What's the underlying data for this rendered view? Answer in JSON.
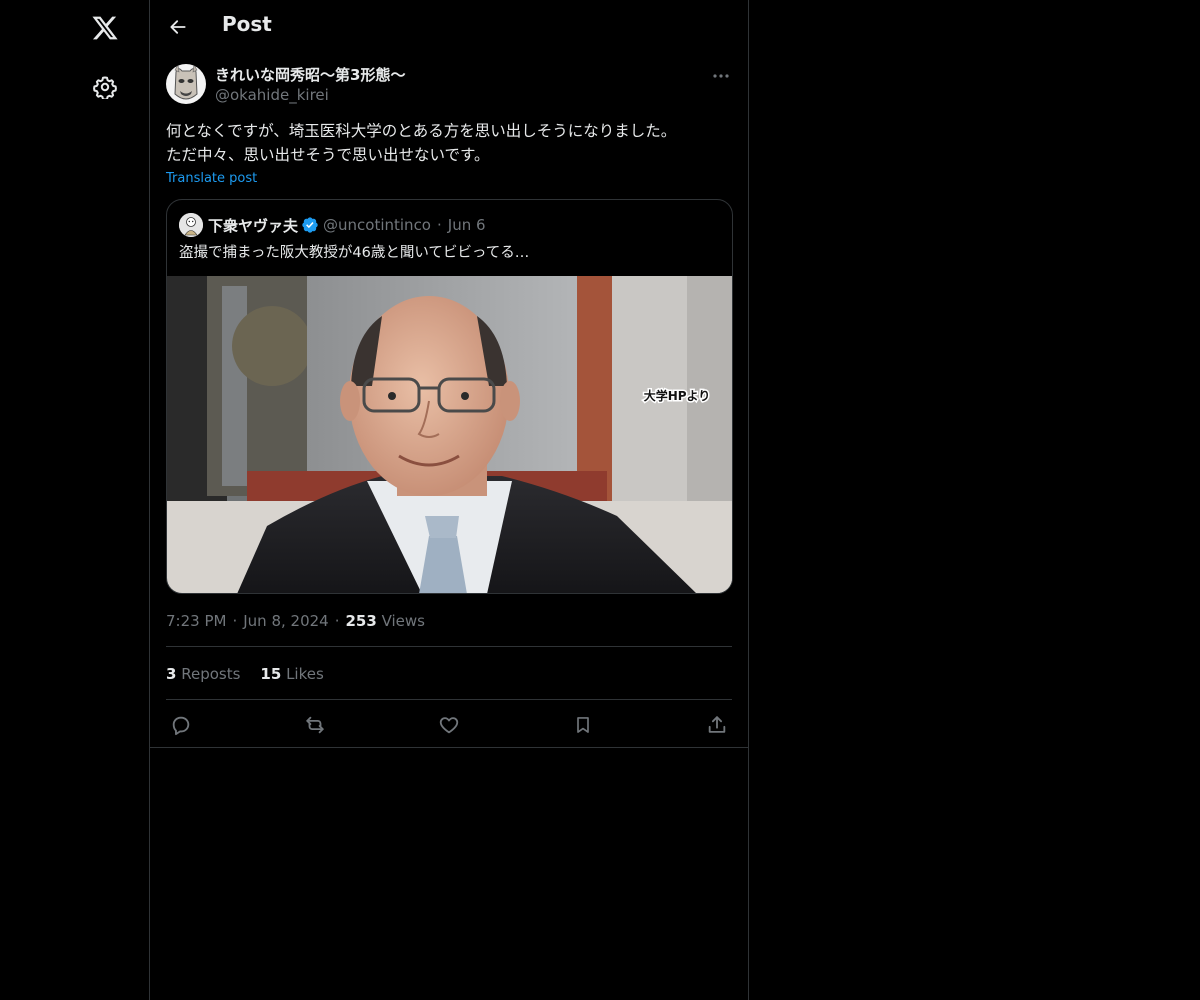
{
  "header": {
    "title": "Post"
  },
  "author": {
    "name": "きれいな岡秀昭〜第3形態〜",
    "handle": "@okahide_kirei"
  },
  "post": {
    "text": "何となくですが、埼玉医科大学のとある方を思い出しそうになりました。\nただ中々、思い出せそうで思い出せないです。",
    "translate_label": "Translate post"
  },
  "quote": {
    "name": "下衆ヤヴァ夫",
    "handle": "@uncotintinco",
    "dot": "·",
    "date": "Jun 6",
    "text": "盗撮で捕まった阪大教授が46歳と聞いてビビってる…",
    "image_caption": "大学HPより"
  },
  "meta": {
    "time": "7:23 PM",
    "date": "Jun 8, 2024",
    "views_count": "253",
    "views_label": "Views",
    "dot": "·"
  },
  "stats": {
    "reposts_count": "3",
    "reposts_label": "Reposts",
    "likes_count": "15",
    "likes_label": "Likes"
  },
  "icons": {
    "logo": "x-logo-icon",
    "settings": "gear-icon",
    "back": "arrow-left-icon",
    "more": "more-horizontal-icon",
    "verified": "verified-badge-icon",
    "reply": "reply-icon",
    "repost": "repost-icon",
    "like": "heart-icon",
    "bookmark": "bookmark-icon",
    "share": "share-icon"
  },
  "colors": {
    "background": "#000000",
    "text": "#e7e9ea",
    "secondary_text": "#71767b",
    "accent": "#1d9bf0",
    "border": "#2f3336"
  }
}
